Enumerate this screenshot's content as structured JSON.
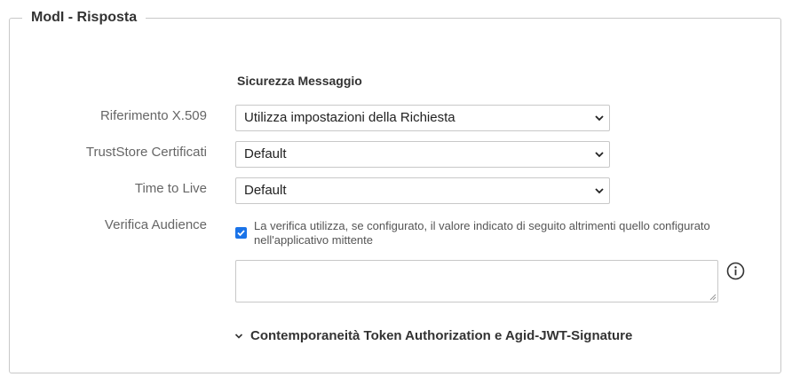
{
  "panel": {
    "legend": "ModI - Risposta"
  },
  "section": {
    "title": "Sicurezza Messaggio"
  },
  "fields": {
    "riferimento": {
      "label": "Riferimento X.509",
      "value": "Utilizza impostazioni della Richiesta"
    },
    "truststore": {
      "label": "TrustStore Certificati",
      "value": "Default"
    },
    "ttl": {
      "label": "Time to Live",
      "value": "Default"
    },
    "audience": {
      "label": "Verifica Audience",
      "checked": true,
      "checkbox_text": "La verifica utilizza, se configurato, il valore indicato di seguito altrimenti quello configurato nell'applicativo mittente",
      "textarea_value": ""
    }
  },
  "collapsible": {
    "label": "Contemporaneità Token Authorization e Agid-JWT-Signature",
    "icon": "chevron-down-icon"
  },
  "icons": {
    "info": "info-circle-icon"
  },
  "colors": {
    "checkbox_accent": "#1a73e8",
    "border": "#c8c8c8",
    "label_text": "#666666"
  }
}
